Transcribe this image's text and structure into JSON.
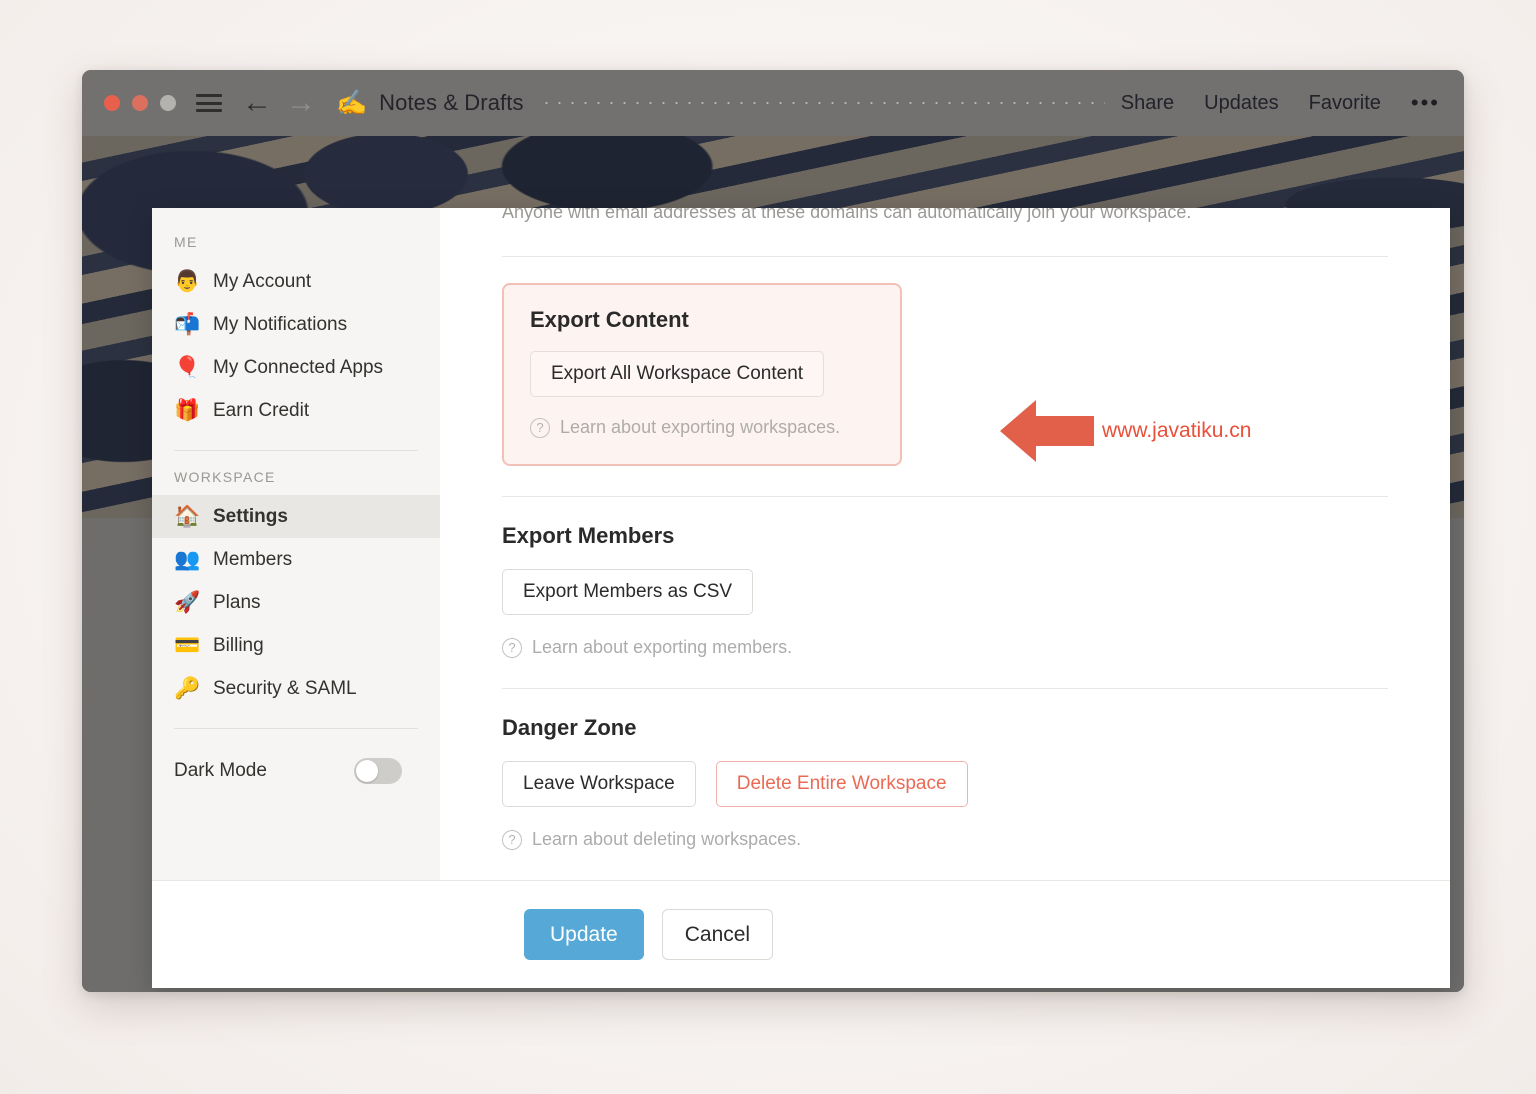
{
  "window": {
    "traffic_lights": [
      "close",
      "minimize",
      "zoom"
    ],
    "menu_icon": "hamburger-icon",
    "back_icon": "arrow-left-icon",
    "forward_icon": "arrow-right-icon",
    "doc_emoji": "✍️",
    "doc_title": "Notes & Drafts",
    "actions": [
      {
        "label": "Share",
        "name": "share"
      },
      {
        "label": "Updates",
        "name": "updates"
      },
      {
        "label": "Favorite",
        "name": "favorite"
      }
    ],
    "more_label": "•••",
    "help_label": "?"
  },
  "sidebar": {
    "groups": [
      {
        "heading": "ME",
        "items": [
          {
            "label": "My Account",
            "emoji": "👨",
            "active": false
          },
          {
            "label": "My Notifications",
            "emoji": "📬",
            "active": false
          },
          {
            "label": "My Connected Apps",
            "emoji": "🎈",
            "active": false
          },
          {
            "label": "Earn Credit",
            "emoji": "🎁",
            "active": false
          }
        ]
      },
      {
        "heading": "WORKSPACE",
        "items": [
          {
            "label": "Settings",
            "emoji": "🏠",
            "active": true
          },
          {
            "label": "Members",
            "emoji": "👥",
            "active": false
          },
          {
            "label": "Plans",
            "emoji": "🚀",
            "active": false
          },
          {
            "label": "Billing",
            "emoji": "💳",
            "active": false
          },
          {
            "label": "Security & SAML",
            "emoji": "🔑",
            "active": false
          }
        ]
      }
    ],
    "dark_mode": {
      "label": "Dark Mode",
      "enabled": false
    }
  },
  "content": {
    "clipped_text": "Anyone with email addresses at these domains can automatically join your workspace.",
    "export_content": {
      "title": "Export Content",
      "button": "Export All Workspace Content",
      "helper": "Learn about exporting workspaces.",
      "highlighted": true,
      "highlight_color": "#f3c0b8"
    },
    "export_members": {
      "title": "Export Members",
      "button": "Export Members as CSV",
      "helper": "Learn about exporting members."
    },
    "danger_zone": {
      "title": "Danger Zone",
      "leave_button": "Leave Workspace",
      "delete_button": "Delete Entire Workspace",
      "delete_color": "#ea6a55",
      "helper": "Learn about deleting workspaces."
    }
  },
  "footer": {
    "update_label": "Update",
    "update_color": "#56a9d6",
    "cancel_label": "Cancel"
  },
  "annotation": {
    "arrow": "arrow-left-annotation",
    "arrow_color": "#e2604a",
    "url": "www.javatiku.cn",
    "url_color": "#e8503a"
  }
}
